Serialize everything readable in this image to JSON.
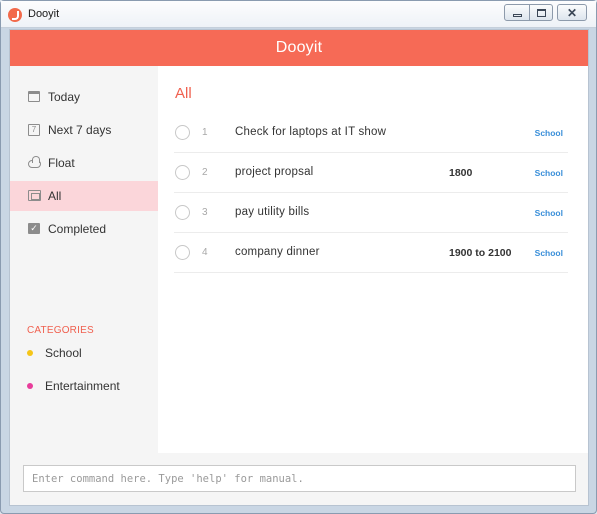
{
  "window": {
    "title": "Dooyit",
    "buttons": {
      "minimize": "minimize",
      "maximize": "maximize",
      "close": "✕"
    }
  },
  "header": {
    "title": "Dooyit",
    "color": "#f66a56"
  },
  "sidebar": {
    "items": [
      {
        "label": "Today",
        "icon": "calendar-icon",
        "active": false
      },
      {
        "label": "Next 7 days",
        "icon": "calendar-7-icon",
        "icon_text": "7",
        "active": false
      },
      {
        "label": "Float",
        "icon": "cloud-icon",
        "active": false
      },
      {
        "label": "All",
        "icon": "all-tasks-icon",
        "active": true
      },
      {
        "label": "Completed",
        "icon": "completed-check-icon",
        "icon_text": "✓",
        "active": false
      }
    ],
    "categories_title": "CATEGORIES",
    "categories": [
      {
        "label": "School",
        "color": "#f5c518"
      },
      {
        "label": "Entertainment",
        "color": "#e83d9b"
      }
    ]
  },
  "main": {
    "title": "All",
    "tasks": [
      {
        "num": "1",
        "text": "Check for laptops at IT show",
        "time": "",
        "category": "School"
      },
      {
        "num": "2",
        "text": "project propsal",
        "time": "1800",
        "category": "School"
      },
      {
        "num": "3",
        "text": "pay utility bills",
        "time": "",
        "category": "School"
      },
      {
        "num": "4",
        "text": "company dinner",
        "time": "1900 to 2100",
        "category": "School"
      }
    ]
  },
  "command": {
    "value": "",
    "placeholder": "Enter command here. Type 'help' for manual."
  },
  "colors": {
    "accent": "#f66a56",
    "active_nav": "#fbd6da",
    "category_link": "#3a8fd9"
  }
}
